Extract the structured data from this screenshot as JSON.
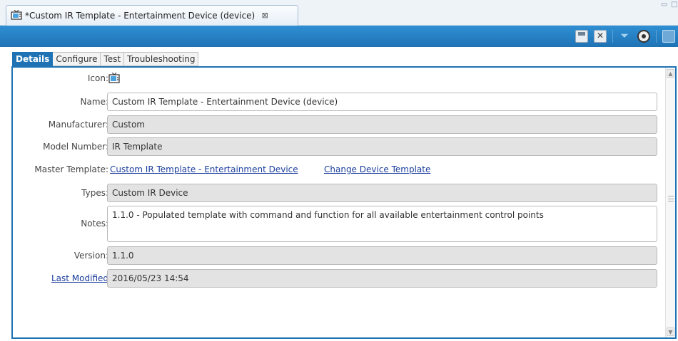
{
  "editor_tab": {
    "title": "*Custom IR Template - Entertainment Device (device)",
    "close_glyph": "⊠",
    "icon": "tv-icon"
  },
  "window_controls": {
    "minimize_glyph": "▭",
    "maximize_glyph": "□"
  },
  "toolbar": {
    "icons": [
      "save-icon",
      "discard-icon",
      "filter-icon",
      "gear-icon",
      "help-icon"
    ]
  },
  "tabs": [
    {
      "label": "Details",
      "active": true
    },
    {
      "label": "Configure",
      "active": false
    },
    {
      "label": "Test",
      "active": false
    },
    {
      "label": "Troubleshooting",
      "active": false
    }
  ],
  "form": {
    "icon_label": "Icon:",
    "name_label": "Name:",
    "name_value": "Custom IR Template - Entertainment Device (device)",
    "manufacturer_label": "Manufacturer:",
    "manufacturer_value": "Custom",
    "model_label": "Model Number:",
    "model_value": "IR Template",
    "master_label": "Master Template:",
    "master_link": "Custom IR Template - Entertainment Device",
    "change_link": "Change Device Template",
    "types_label": "Types:",
    "types_value": "Custom IR Device",
    "notes_label": "Notes:",
    "notes_value": "1.1.0 - Populated template with command and function for all available entertainment control points",
    "version_label": "Version:",
    "version_value": "1.1.0",
    "modified_label": "Last Modified",
    "modified_value": "2016/05/23 14:54"
  },
  "colors": {
    "accent": "#1f73b4",
    "link": "#1a3d9c",
    "readonly_bg": "#e3e3e3"
  }
}
